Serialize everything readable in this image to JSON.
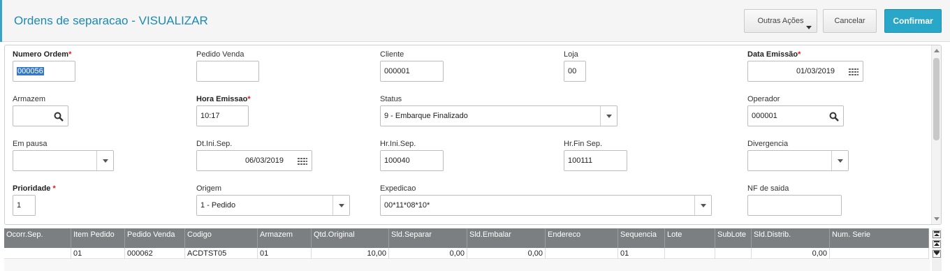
{
  "header": {
    "title": "Ordens de separacao - VISUALIZAR",
    "buttons": {
      "other_actions": "Outras Ações",
      "cancel": "Cancelar",
      "confirm": "Confirmar"
    }
  },
  "form": {
    "numero_ordem": {
      "label": "Numero Ordem",
      "value": "000056"
    },
    "pedido_venda": {
      "label": "Pedido Venda",
      "value": ""
    },
    "cliente": {
      "label": "Cliente",
      "value": "000001"
    },
    "loja": {
      "label": "Loja",
      "value": "00"
    },
    "data_emissao": {
      "label": "Data Emissão",
      "value": "01/03/2019"
    },
    "armazem": {
      "label": "Armazem",
      "value": ""
    },
    "hora_emissao": {
      "label": "Hora Emissao",
      "value": "10:17"
    },
    "status": {
      "label": "Status",
      "value": "9 - Embarque Finalizado"
    },
    "operador": {
      "label": "Operador",
      "value": "000001"
    },
    "em_pausa": {
      "label": "Em pausa",
      "value": ""
    },
    "dt_ini_sep": {
      "label": "Dt.Ini.Sep.",
      "value": "06/03/2019"
    },
    "hr_ini_sep": {
      "label": "Hr.Ini.Sep.",
      "value": "100040"
    },
    "hr_fin_sep": {
      "label": "Hr.Fin Sep.",
      "value": "100111"
    },
    "divergencia": {
      "label": "Divergencia",
      "value": ""
    },
    "prioridade": {
      "label": "Prioridade",
      "value": "1"
    },
    "origem": {
      "label": "Origem",
      "value": "1 - Pedido"
    },
    "expedicao": {
      "label": "Expedicao",
      "value": "00*11*08*10*"
    },
    "nf_saida": {
      "label": "NF de saida",
      "value": ""
    },
    "required_mark": "*"
  },
  "grid": {
    "columns": [
      "Ocorr.Sep.",
      "Item Pedido",
      "Pedido Venda",
      "Codigo",
      "Armazem",
      "Qtd.Original",
      "Sld.Separar",
      "Sld.Embalar",
      "Endereco",
      "Sequencia",
      "Lote",
      "SubLote",
      "Sld.Distrib.",
      "Num. Serie"
    ],
    "rows": [
      [
        "",
        "01",
        "000062",
        "ACDTST05",
        "01",
        "10,00",
        "0,00",
        "0,00",
        "",
        "01",
        "",
        "",
        "0,00",
        ""
      ]
    ]
  },
  "icons": [
    "search-icon",
    "calendar-icon",
    "chevron-down-icon",
    "scroll-top-icon",
    "scroll-up-icon"
  ],
  "colors": {
    "accent": "#1b8ab3",
    "confirm": "#29a7c9",
    "required": "#d62020",
    "grid_header": "#7b7f82",
    "selection": "#3478c6"
  }
}
